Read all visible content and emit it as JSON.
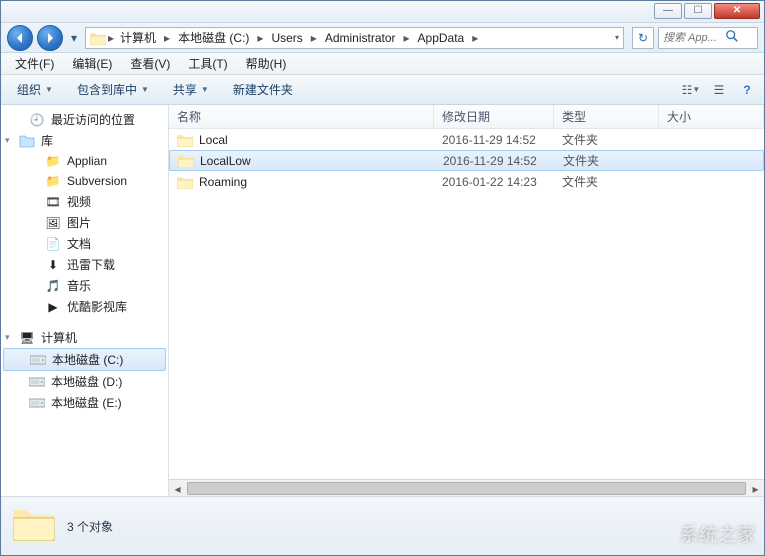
{
  "titlebar": {
    "min": "—",
    "max": "☐",
    "close": "✕"
  },
  "nav": {
    "path": [
      "计算机",
      "本地磁盘 (C:)",
      "Users",
      "Administrator",
      "AppData"
    ],
    "search_placeholder": "搜索 App..."
  },
  "menubar": {
    "items": [
      "文件(F)",
      "编辑(E)",
      "查看(V)",
      "工具(T)",
      "帮助(H)"
    ]
  },
  "toolbar": {
    "organize": "组织",
    "include": "包含到库中",
    "share": "共享",
    "newfolder": "新建文件夹"
  },
  "columns": {
    "name": "名称",
    "date": "修改日期",
    "type": "类型",
    "size": "大小"
  },
  "sidebar": {
    "recent": "最近访问的位置",
    "libraries": "库",
    "lib_items": [
      "Applian",
      "Subversion",
      "视频",
      "图片",
      "文档",
      "迅雷下载",
      "音乐",
      "优酷影视库"
    ],
    "computer": "计算机",
    "drives": [
      "本地磁盘 (C:)",
      "本地磁盘 (D:)",
      "本地磁盘 (E:)"
    ]
  },
  "rows": [
    {
      "name": "Local",
      "date": "2016-11-29 14:52",
      "type": "文件夹",
      "selected": false
    },
    {
      "name": "LocalLow",
      "date": "2016-11-29 14:52",
      "type": "文件夹",
      "selected": true
    },
    {
      "name": "Roaming",
      "date": "2016-01-22 14:23",
      "type": "文件夹",
      "selected": false
    }
  ],
  "status": {
    "count": "3 个对象"
  },
  "watermark": "系统之家"
}
